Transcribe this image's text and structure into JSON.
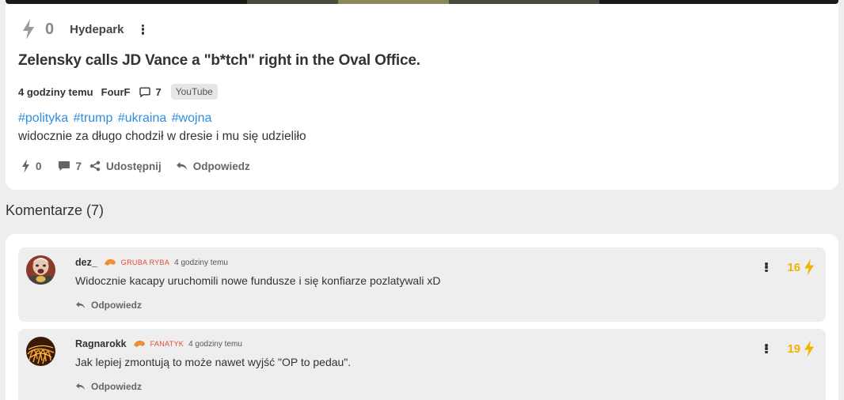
{
  "post": {
    "votes": "0",
    "group": "Hydepark",
    "title": "Zelensky calls JD Vance a \"b*tch\" right in the Oval Office.",
    "time": "4 godziny temu",
    "author": "FourF",
    "comment_count": "7",
    "source": "YouTube",
    "tags": [
      "#polityka",
      "#trump",
      "#ukraina",
      "#wojna"
    ],
    "body": "widocznie za długo chodził w dresie i mu się udzieliło",
    "actions": {
      "votes": "0",
      "comments": "7",
      "share_label": "Udostępnij",
      "reply_label": "Odpowiedz"
    }
  },
  "comments_section": {
    "title": "Komentarze (7)"
  },
  "comments": [
    {
      "user": "dez_",
      "rank": "GRUBA RYBA",
      "time": "4 godziny temu",
      "text": "Widocznie kacapy uruchomili nowe fundusze i się konfiarze pozlatywali xD",
      "score": "16",
      "reply_label": "Odpowiedz"
    },
    {
      "user": "Ragnarokk",
      "rank": "FANATYK",
      "time": "4 godziny temu",
      "text": "Jak lepiej zmontują to może nawet wyjść \"OP to pedau\".",
      "score": "19",
      "reply_label": "Odpowiedz"
    }
  ],
  "colors": {
    "accent_link": "#2f8ee0",
    "score": "#f0b400",
    "rank": "#e4483a",
    "background": "#eeeeee"
  },
  "icons": [
    "bolt-icon",
    "more-vertical-icon",
    "comment-icon",
    "share-icon",
    "reply-icon",
    "rank-icon"
  ]
}
